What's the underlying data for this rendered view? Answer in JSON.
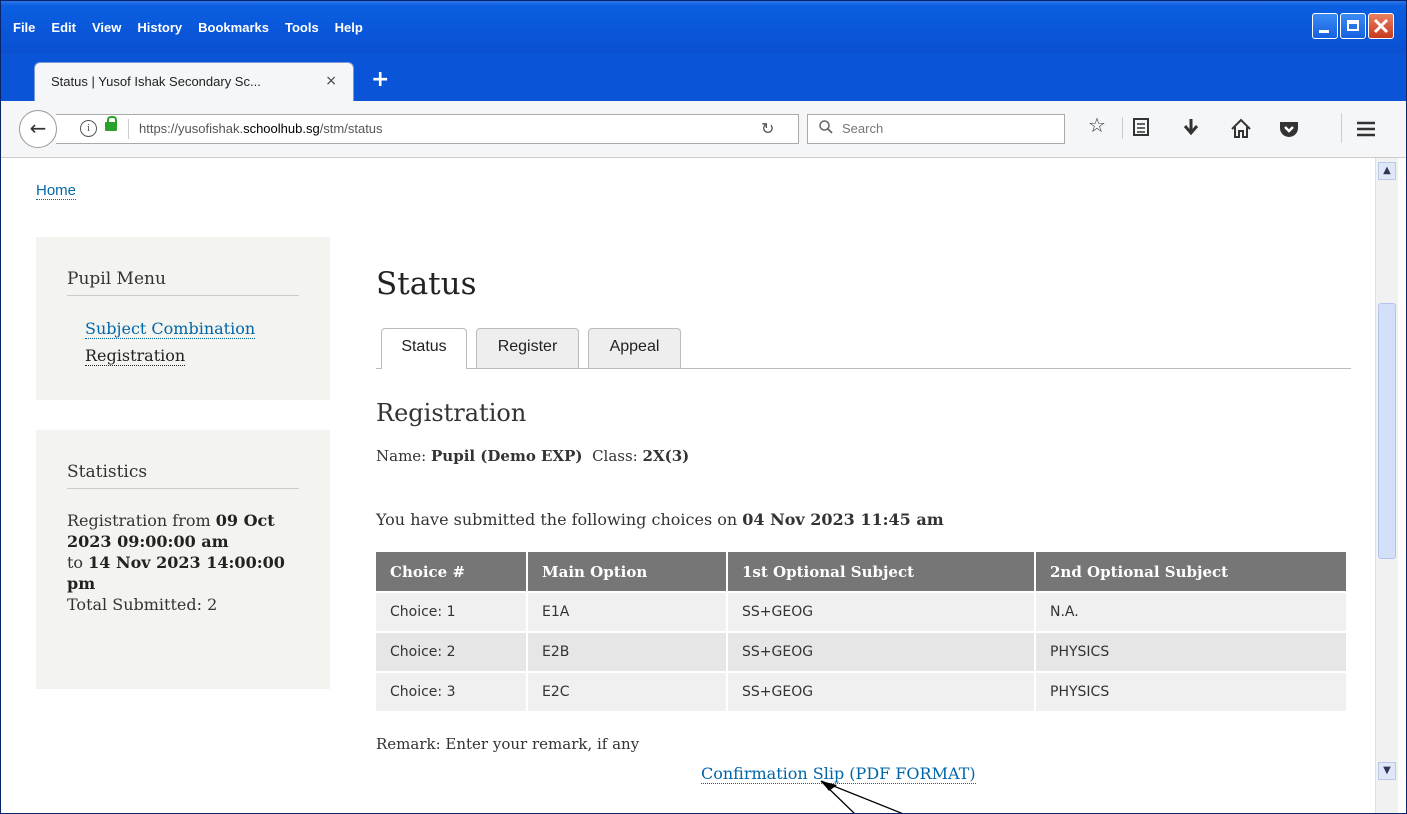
{
  "browser": {
    "menu": [
      "File",
      "Edit",
      "View",
      "History",
      "Bookmarks",
      "Tools",
      "Help"
    ],
    "tab_title": "Status | Yusof Ishak Secondary Sc...",
    "tab_close": "×",
    "new_tab": "+",
    "url_prefix": "https://yusofishak.",
    "url_host": "schoolhub.sg",
    "url_path": "/stm/status",
    "search_placeholder": "Search",
    "icons": [
      "back-icon",
      "info-icon",
      "lock-icon",
      "reload-icon",
      "search-icon",
      "star-icon",
      "reading-list-icon",
      "download-icon",
      "home-icon",
      "pocket-icon",
      "hamburger-menu-icon"
    ]
  },
  "page": {
    "home_link": "Home",
    "pupil_menu": {
      "title": "Pupil Menu",
      "items": [
        "Subject Combination",
        "Registration"
      ]
    },
    "statistics": {
      "title": "Statistics",
      "registration_from_label": "Registration from",
      "from_date": "09 Oct 2023 09:00:00 am",
      "to_label": "to",
      "to_date": "14 Nov 2023 14:00:00 pm",
      "total_submitted_label": "Total Submitted:",
      "total_submitted": "2"
    },
    "title": "Status",
    "tabs": [
      "Status",
      "Register",
      "Appeal"
    ],
    "active_tab": "Status",
    "section_title": "Registration",
    "name_label": "Name:",
    "name_value": "Pupil (Demo EXP)",
    "class_label": "Class:",
    "class_value": "2X(3)",
    "submitted_text": "You have submitted the following choices on",
    "submitted_date": "04 Nov 2023 11:45 am",
    "table": {
      "headers": [
        "Choice #",
        "Main Option",
        "1st Optional Subject",
        "2nd Optional Subject"
      ],
      "rows": [
        [
          "Choice: 1",
          "E1A",
          "SS+GEOG",
          "N.A."
        ],
        [
          "Choice: 2",
          "E2B",
          "SS+GEOG",
          "PHYSICS"
        ],
        [
          "Choice: 3",
          "E2C",
          "SS+GEOG",
          "PHYSICS"
        ]
      ]
    },
    "remark": "Remark: Enter your remark, if any",
    "pdf_link": "Confirmation Slip (PDF FORMAT)"
  }
}
